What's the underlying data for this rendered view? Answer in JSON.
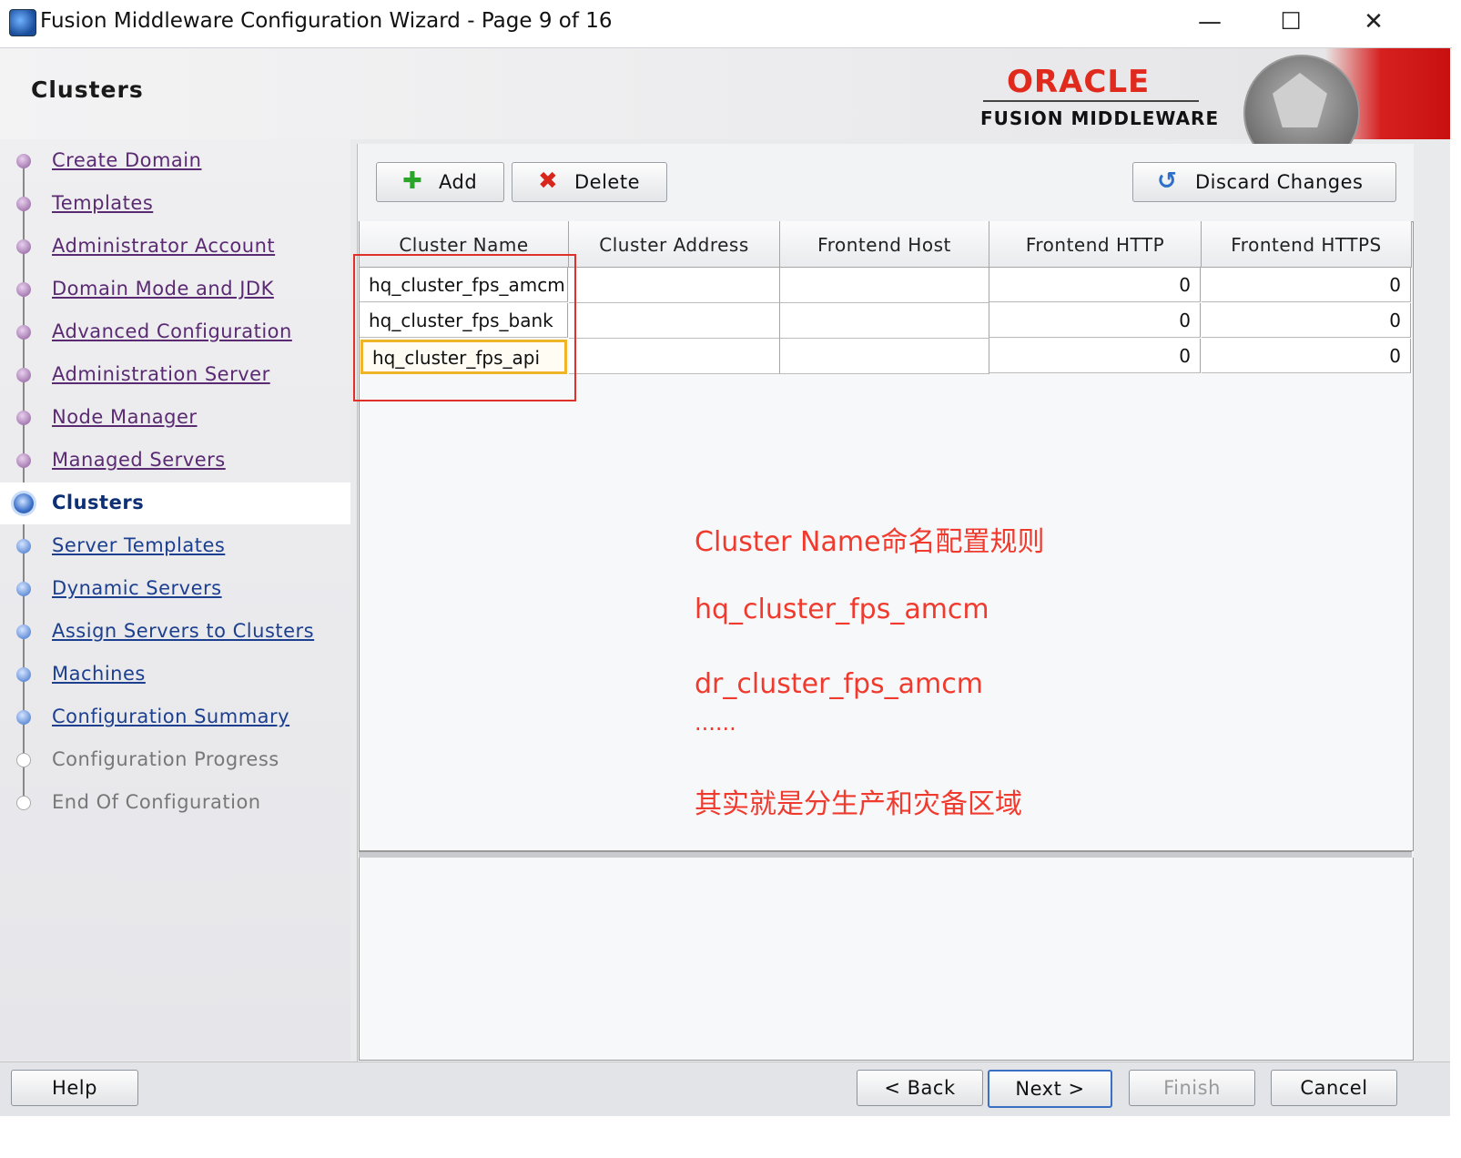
{
  "window": {
    "title": "Fusion Middleware Configuration Wizard - Page 9 of 16",
    "minimize": "—",
    "maximize": "☐",
    "close": "✕"
  },
  "header": {
    "page_title": "Clusters",
    "oracle_logo": "ORACLE",
    "fusion_middleware": "FUSION MIDDLEWARE"
  },
  "nav": {
    "items": [
      {
        "label": "Create Domain",
        "state": "visited"
      },
      {
        "label": "Templates",
        "state": "visited"
      },
      {
        "label": "Administrator Account",
        "state": "visited"
      },
      {
        "label": "Domain Mode and JDK",
        "state": "visited"
      },
      {
        "label": "Advanced Configuration",
        "state": "visited"
      },
      {
        "label": "Administration Server",
        "state": "visited"
      },
      {
        "label": "Node Manager",
        "state": "visited"
      },
      {
        "label": "Managed Servers",
        "state": "visited"
      },
      {
        "label": "Clusters",
        "state": "current"
      },
      {
        "label": "Server Templates",
        "state": "todo"
      },
      {
        "label": "Dynamic Servers",
        "state": "todo"
      },
      {
        "label": "Assign Servers to Clusters",
        "state": "todo"
      },
      {
        "label": "Machines",
        "state": "todo"
      },
      {
        "label": "Configuration Summary",
        "state": "todo"
      },
      {
        "label": "Configuration Progress",
        "state": "disabled"
      },
      {
        "label": "End Of Configuration",
        "state": "disabled"
      }
    ]
  },
  "toolbar": {
    "add_label": "Add",
    "delete_label": "Delete",
    "discard_label": "Discard Changes"
  },
  "table": {
    "columns": [
      "Cluster Name",
      "Cluster Address",
      "Frontend Host",
      "Frontend HTTP",
      "Frontend HTTPS"
    ],
    "rows": [
      {
        "name": "hq_cluster_fps_amcm",
        "address": "",
        "host": "",
        "http": "0",
        "https": "0"
      },
      {
        "name": "hq_cluster_fps_bank",
        "address": "",
        "host": "",
        "http": "0",
        "https": "0"
      },
      {
        "name": "hq_cluster_fps_api",
        "address": "",
        "host": "",
        "http": "0",
        "https": "0"
      }
    ]
  },
  "annotation": {
    "line1": "Cluster Name命名配置规则",
    "line2": "hq_cluster_fps_amcm",
    "line3": "dr_cluster_fps_amcm",
    "line4": "......",
    "line5": "其实就是分生产和灾备区域"
  },
  "footer": {
    "help": "Help",
    "back": "< Back",
    "next": "Next >",
    "finish": "Finish",
    "cancel": "Cancel"
  },
  "colors": {
    "oracle_red": "#e02a1d",
    "annotation_red": "#f03a2e",
    "selection_yellow": "#f0b429"
  }
}
